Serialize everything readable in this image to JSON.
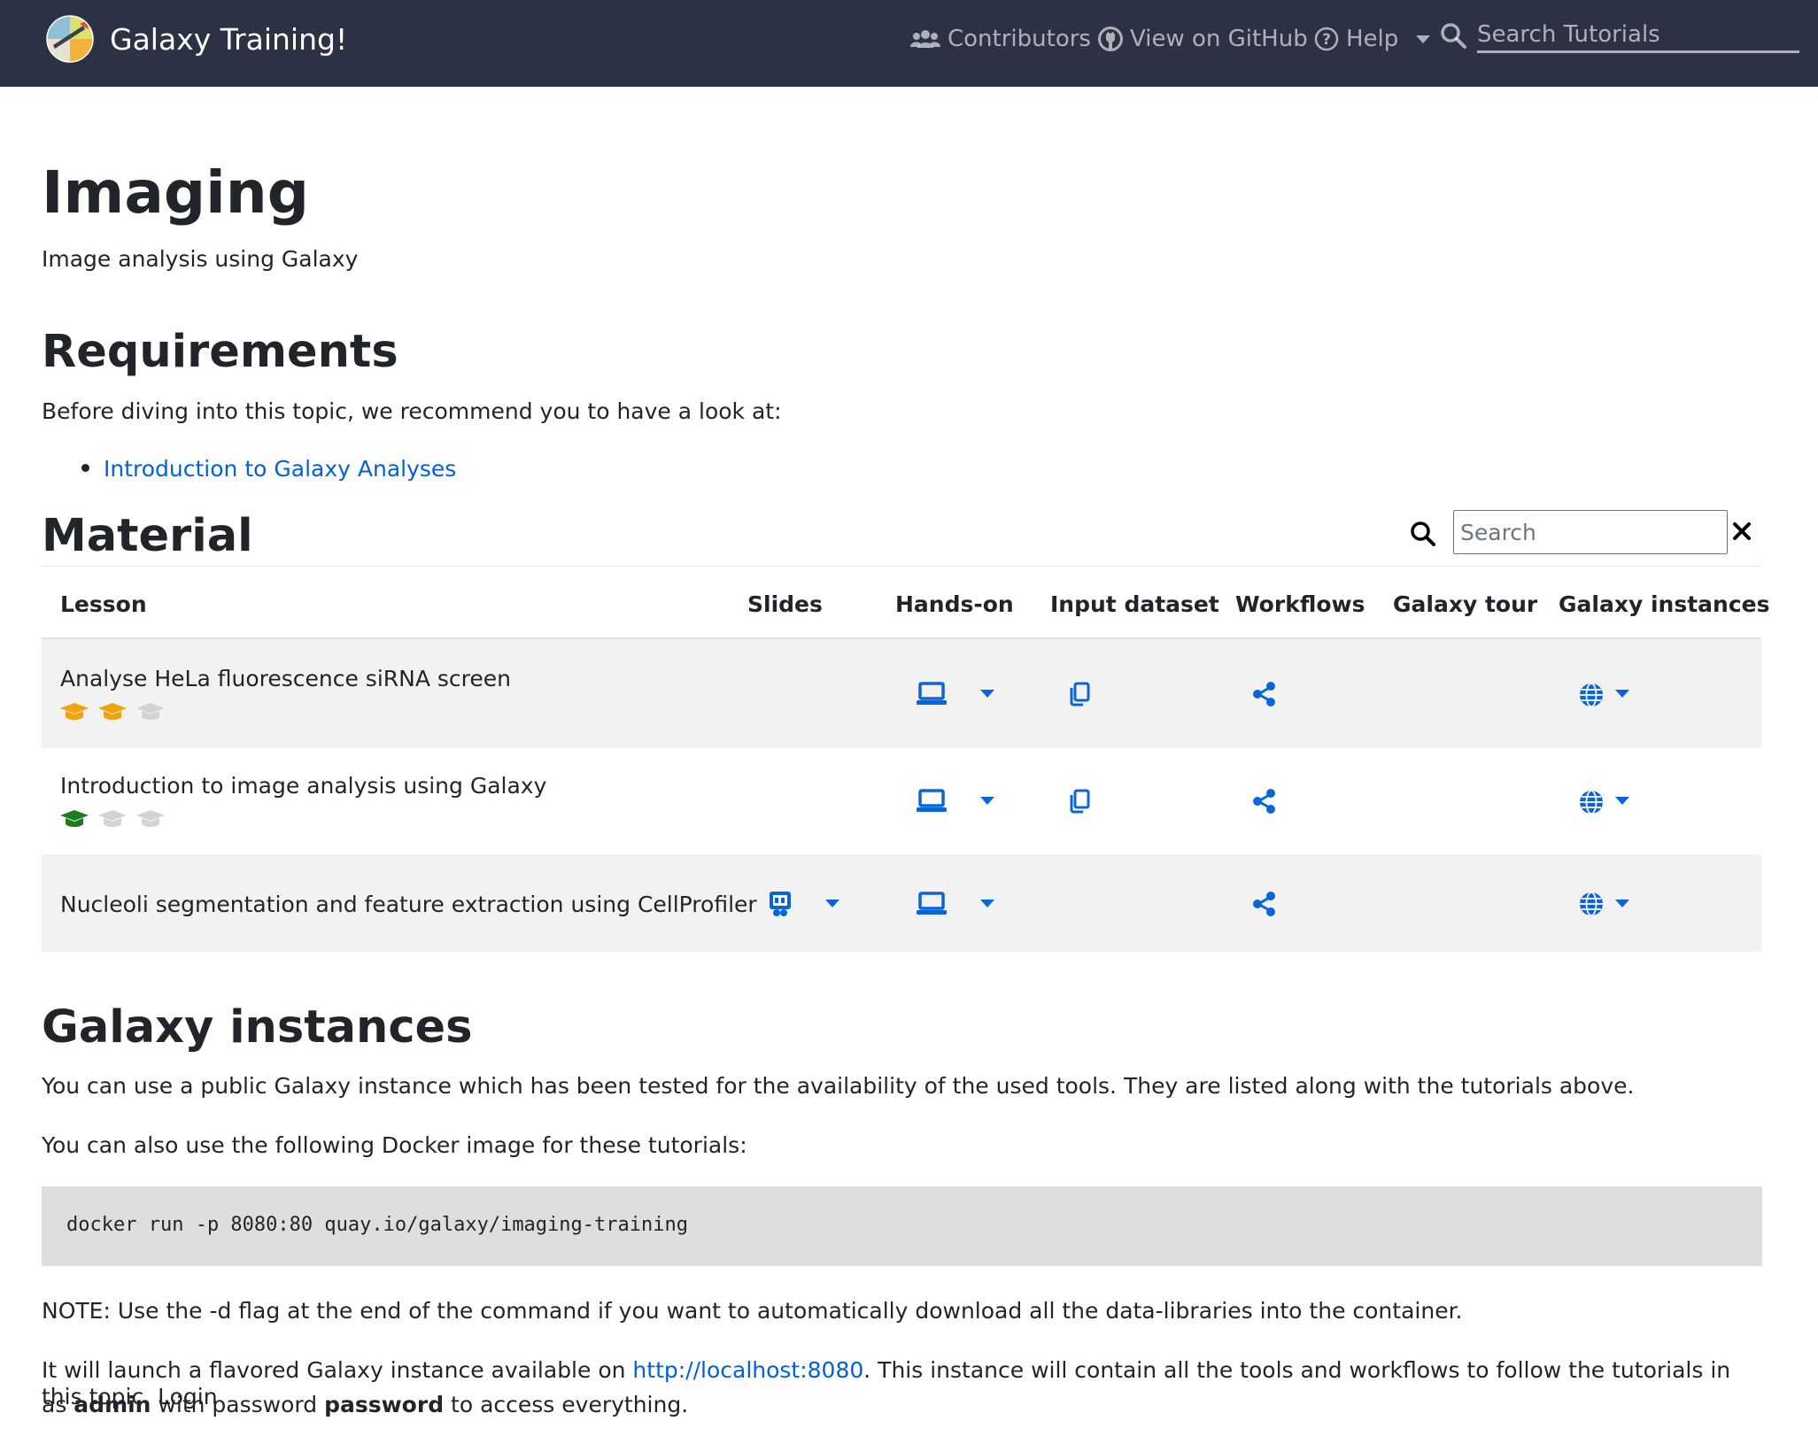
{
  "navbar": {
    "brand": "Galaxy Training!",
    "contributors": "Contributors",
    "github": "View on GitHub",
    "help": "Help",
    "search_placeholder": "Search Tutorials"
  },
  "page": {
    "title": "Imaging",
    "subtitle": "Image analysis using Galaxy"
  },
  "requirements": {
    "heading": "Requirements",
    "intro": "Before diving into this topic, we recommend you to have a look at:",
    "items": [
      "Introduction to Galaxy Analyses"
    ]
  },
  "material": {
    "heading": "Material",
    "search_placeholder": "Search",
    "columns": [
      "Lesson",
      "Slides",
      "Hands-on",
      "Input dataset",
      "Workflows",
      "Galaxy tour",
      "Galaxy instances"
    ],
    "rows": [
      {
        "title": "Analyse HeLa fluorescence siRNA screen",
        "level": 2,
        "slides": false,
        "handson": true,
        "dataset": true,
        "workflow": true,
        "instances": true
      },
      {
        "title": "Introduction to image analysis using Galaxy",
        "level": 1,
        "slides": false,
        "handson": true,
        "dataset": true,
        "workflow": true,
        "instances": true
      },
      {
        "title": "Nucleoli segmentation and feature extraction using CellProfiler",
        "level": 0,
        "slides": true,
        "handson": true,
        "dataset": false,
        "workflow": true,
        "instances": true
      }
    ]
  },
  "instances": {
    "heading": "Galaxy instances",
    "p1": "You can use a public Galaxy instance which has been tested for the availability of the used tools. They are listed along with the tutorials above.",
    "p2": "You can also use the following Docker image for these tutorials:",
    "code": "docker run -p 8080:80 quay.io/galaxy/imaging-training",
    "note": "NOTE: Use the -d flag at the end of the command if you want to automatically download all the data-libraries into the container.",
    "launch_a": "It will launch a flavored Galaxy instance available on ",
    "launch_link": "http://localhost:8080",
    "launch_b": ". This instance will contain all the tools and workflows to follow the tutorials in this topic. Login",
    "launch_c1": "as ",
    "login_user": "admin",
    "launch_c2": " with password ",
    "login_pass": "password",
    "launch_c3": " to access everything."
  },
  "colors": {
    "navbar_bg": "#2c3143",
    "link": "#0060df",
    "icon_blue": "#0a66d8",
    "hat_intermediate": "#f0a30a",
    "hat_beginner": "#1e7d1e",
    "hat_inactive": "#d3d3d3",
    "row_stripe": "#f2f2f2",
    "code_bg": "#dedede"
  }
}
